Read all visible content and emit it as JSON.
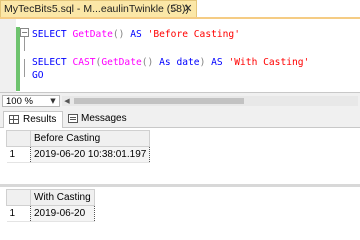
{
  "tab": {
    "title": "MyTecBits5.sql - M...eaulinTwinkle (58))",
    "pin_icon": "pin-icon",
    "close_icon": "close-icon"
  },
  "editor": {
    "line1": {
      "kw1": "SELECT",
      "fn": "GetDate",
      "parens": "()",
      "kw2": "AS",
      "str": "'Before Casting'"
    },
    "line2": {
      "kw1": "SELECT",
      "fn": "CAST",
      "open": "(",
      "fn2": "GetDate",
      "parens": "()",
      "kw_as": "As",
      "type": "date",
      "close": ")",
      "kw2": "AS",
      "str": "'With Casting'"
    },
    "line3": "GO"
  },
  "zoom": {
    "value": "100 %",
    "dropdown_icon": "chevron-down-icon"
  },
  "results_tabs": [
    {
      "label": "Results",
      "icon": "grid-icon"
    },
    {
      "label": "Messages",
      "icon": "message-icon"
    }
  ],
  "result_sets": [
    {
      "column": "Before Casting",
      "rows": [
        {
          "row": "1",
          "value": "2019-06-20 10:38:01.197"
        }
      ]
    },
    {
      "column": "With Casting",
      "rows": [
        {
          "row": "1",
          "value": "2019-06-20"
        }
      ]
    }
  ],
  "colors": {
    "tab_active": "#fbe7a7",
    "keyword": "#0000ff",
    "function": "#ff00ff",
    "string": "#ff0000",
    "change_marker": "#6ec36e"
  }
}
